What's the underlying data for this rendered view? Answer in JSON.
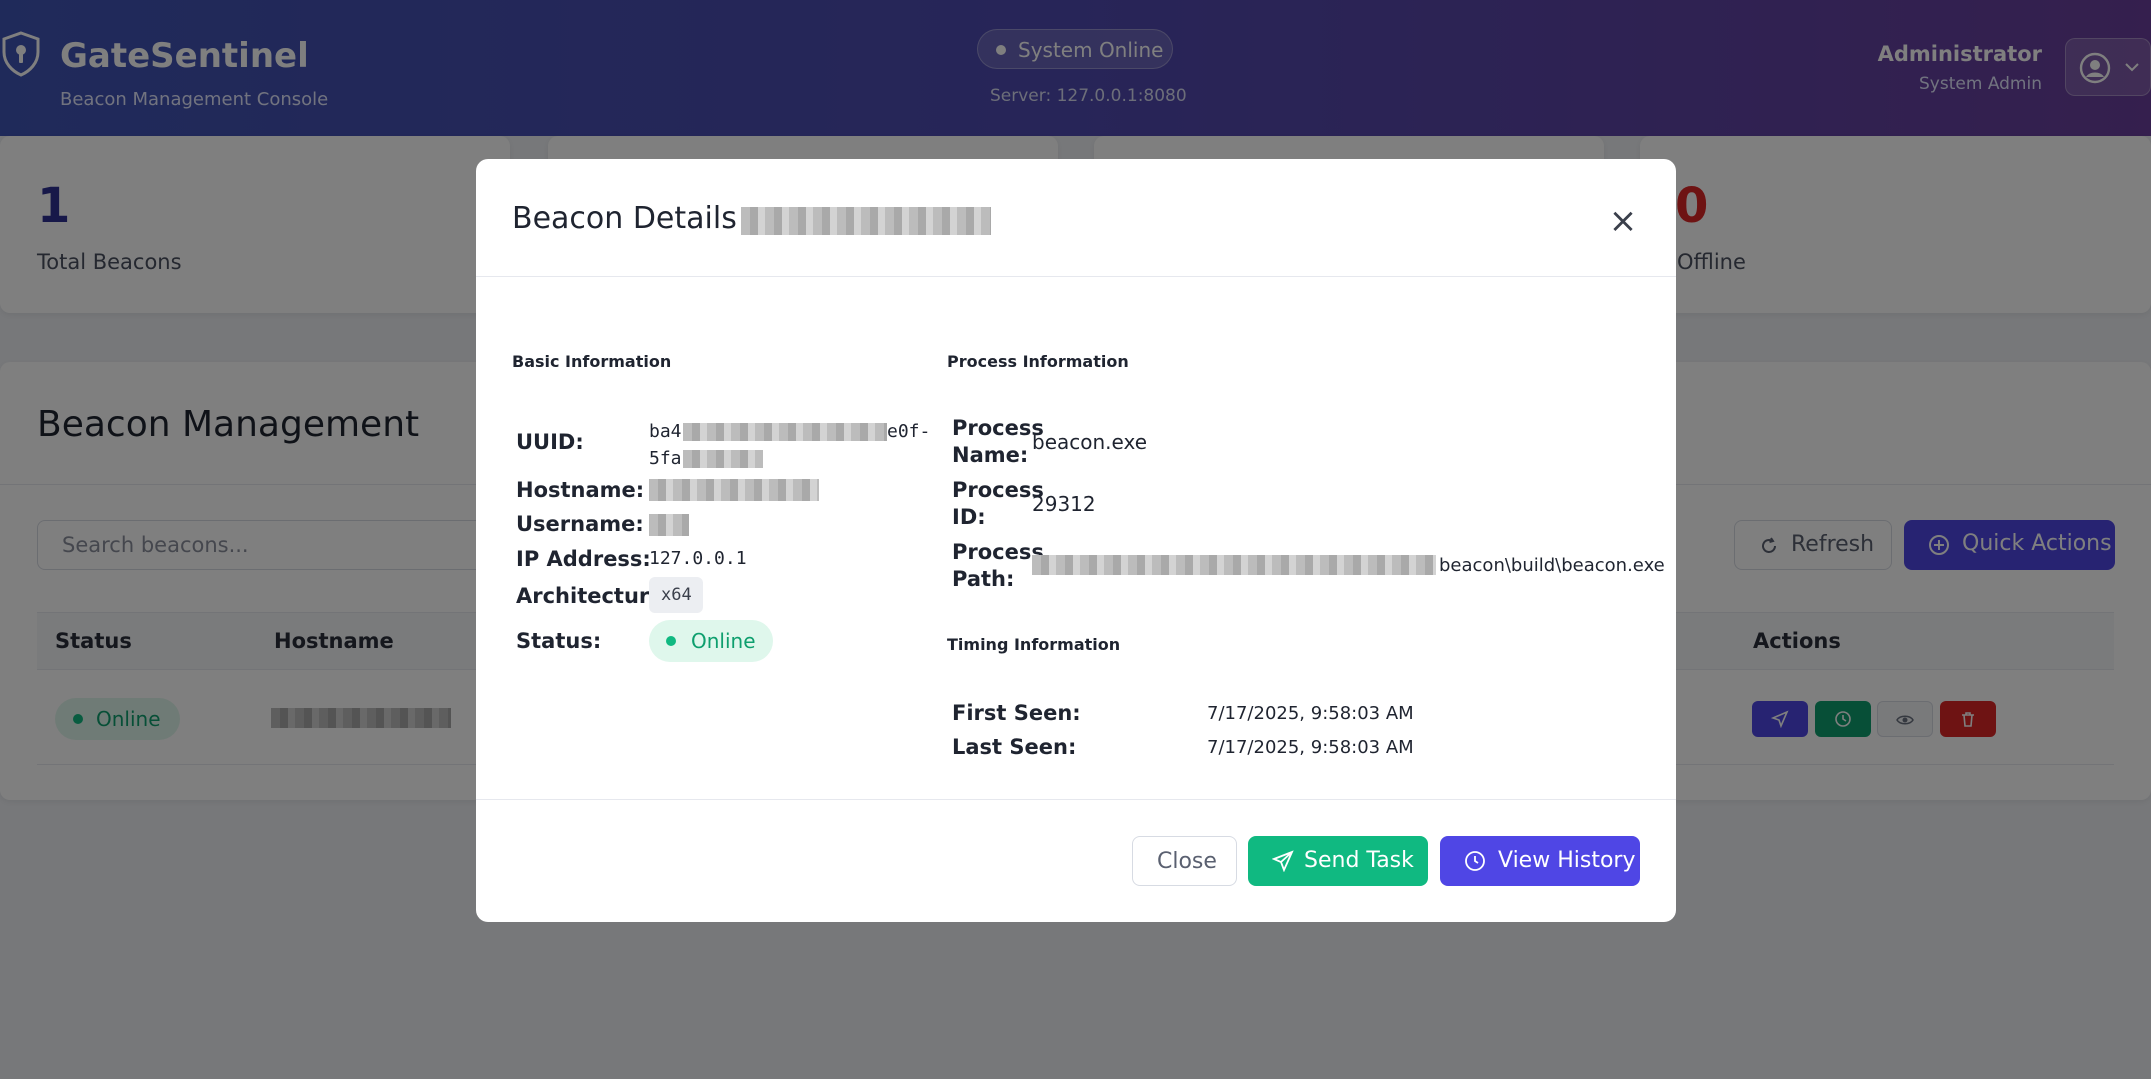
{
  "header": {
    "brand": "GateSentinel",
    "subtitle": "Beacon Management Console",
    "status": "System Online",
    "server": "Server: 127.0.0.1:8080",
    "user_name": "Administrator",
    "user_role": "System Admin"
  },
  "stats": [
    {
      "value": "1",
      "label": "Total Beacons",
      "color": "#2e3192"
    },
    {
      "value": "0",
      "label": "Offline",
      "color": "#dc2626"
    }
  ],
  "management": {
    "title": "Beacon Management",
    "search_placeholder": "Search beacons...",
    "refresh_label": "Refresh",
    "quick_actions_label": "Quick Actions",
    "columns": {
      "status": "Status",
      "hostname": "Hostname",
      "actions": "Actions"
    },
    "row": {
      "status": "Online"
    }
  },
  "modal": {
    "title_prefix": "Beacon Details -",
    "basic": {
      "heading": "Basic Information",
      "uuid_label": "UUID:",
      "uuid_line1": "ba4",
      "uuid_line1_end": "e0f-",
      "uuid_line2": "5fa",
      "hostname_label": "Hostname:",
      "username_label": "Username:",
      "ip_label": "IP Address:",
      "ip_value": "127.0.0.1",
      "arch_label": "Architecture:",
      "arch_value": "x64",
      "status_label": "Status:",
      "status_value": "Online"
    },
    "process": {
      "heading": "Process Information",
      "name_label_1": "Process",
      "name_label_2": "Name:",
      "name_value": "beacon.exe",
      "id_label_1": "Process",
      "id_label_2": "ID:",
      "id_value": "29312",
      "path_label_1": "Process",
      "path_label_2": "Path:",
      "path_value_end": "beacon\\build\\beacon.exe"
    },
    "timing": {
      "heading": "Timing Information",
      "first_label": "First Seen:",
      "first_value": "7/17/2025, 9:58:03 AM",
      "last_label": "Last Seen:",
      "last_value": "7/17/2025, 9:58:03 AM"
    },
    "close_label": "Close",
    "send_task_label": "Send Task",
    "view_history_label": "View History"
  },
  "colors": {
    "primary": "#4f46e5",
    "success": "#10b981",
    "danger": "#dc2626",
    "header_gradient_start": "#3f54b4",
    "header_gradient_end": "#6a3f9c"
  }
}
